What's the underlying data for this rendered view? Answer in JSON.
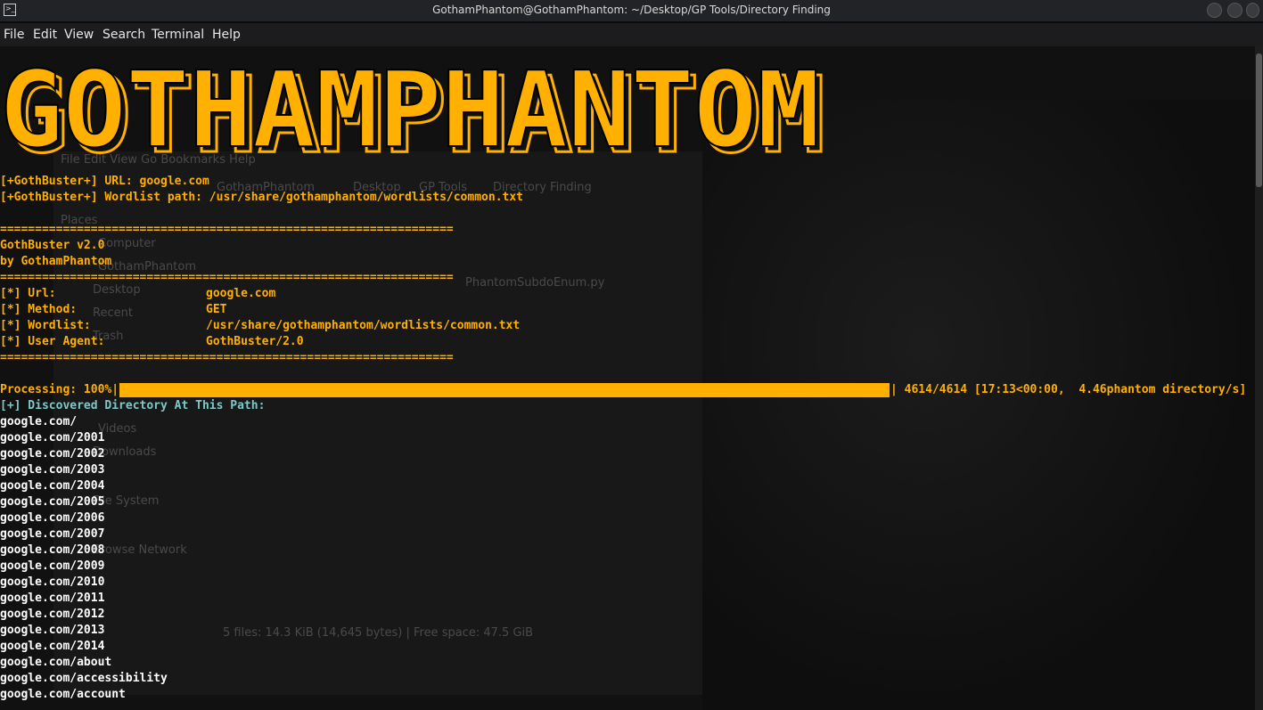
{
  "window": {
    "title": "GothamPhantom@GothamPhantom: ~/Desktop/GP Tools/Directory Finding",
    "app_icon": ">_"
  },
  "menu": [
    "File",
    "Edit",
    "View",
    "Search",
    "Terminal",
    "Help"
  ],
  "banner": "GOTHAMPHANTOM",
  "background_window": {
    "menu": "File  Edit  View  Go  Bookmarks  Help",
    "breadcrumbs": [
      "GothamPhantom",
      "Desktop",
      "GP Tools",
      "Directory Finding"
    ],
    "places_header": "Places",
    "places": [
      "Computer",
      "GothamPhantom",
      "Desktop",
      "Recent",
      "Trash",
      "Videos",
      "Downloads",
      "File System",
      "Browse Network"
    ],
    "files": [
      "PhantomSubdoEnum.py"
    ],
    "status": "5 files: 14.3 KiB (14,645 bytes)  |  Free space: 47.5 GiB"
  },
  "output": {
    "url_line": "[+GothBuster+] URL: google.com",
    "wordlist_line": "[+GothBuster+] Wordlist path: /usr/share/gothamphantom/wordlists/common.txt",
    "separator": "=================================================================",
    "name": "GothBuster v2.0",
    "author": "by GothamPhantom",
    "config": [
      {
        "key": "[*] Url:",
        "value": "google.com"
      },
      {
        "key": "[*] Method:",
        "value": "GET"
      },
      {
        "key": "[*] Wordlist:",
        "value": "/usr/share/gothamphantom/wordlists/common.txt"
      },
      {
        "key": "[*] User Agent:",
        "value": "GothBuster/2.0"
      }
    ],
    "progress_label": "Processing: 100%|",
    "progress_percent": 100,
    "progress_stats": "| 4614/4614 [17:13<00:00,  4.46phantom directory/s]",
    "discovered_header": "[+] Discovered Directory At This Path:",
    "paths": [
      "google.com/",
      "google.com/2001",
      "google.com/2002",
      "google.com/2003",
      "google.com/2004",
      "google.com/2005",
      "google.com/2006",
      "google.com/2007",
      "google.com/2008",
      "google.com/2009",
      "google.com/2010",
      "google.com/2011",
      "google.com/2012",
      "google.com/2013",
      "google.com/2014",
      "google.com/about",
      "google.com/accessibility",
      "google.com/account"
    ]
  },
  "colors": {
    "accent": "#ffb000",
    "text": "#ffffff",
    "info": "#7fc8c8",
    "background": "#111111"
  }
}
